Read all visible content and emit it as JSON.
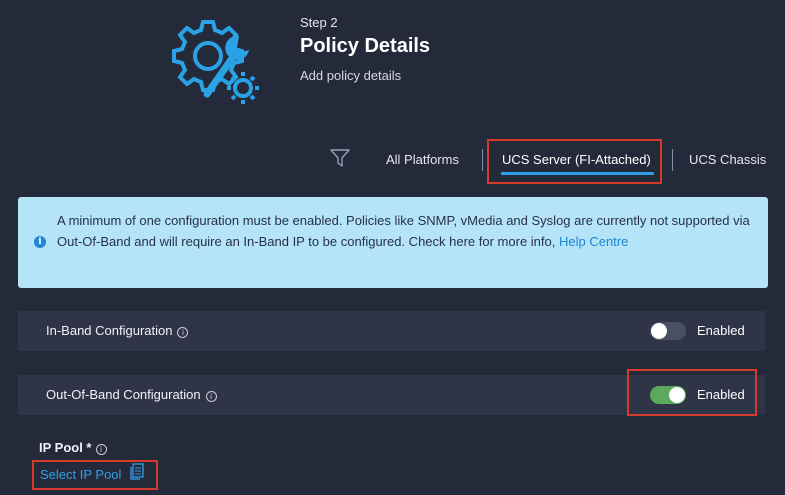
{
  "step": {
    "label": "Step 2",
    "title": "Policy Details",
    "subtitle": "Add policy details",
    "icon": "settings-gear-wrench-icon"
  },
  "platform_tabs": [
    {
      "label": "All Platforms",
      "selected": false
    },
    {
      "label": "UCS Server (FI-Attached)",
      "selected": true
    },
    {
      "label": "UCS Chassis",
      "selected": false
    }
  ],
  "info_banner": {
    "text": "A minimum of one configuration must be enabled. Policies like SNMP, vMedia and Syslog are currently not supported via Out-Of-Band and will require an In-Band IP to be configured. Check here for more info, ",
    "link_text": "Help Centre",
    "icon": "info-icon"
  },
  "inband": {
    "label": "In-Band Configuration",
    "toggle_label": "Enabled",
    "enabled": false
  },
  "oob": {
    "label": "Out-Of-Band Configuration",
    "toggle_label": "Enabled",
    "enabled": true
  },
  "ip_pool": {
    "label": "IP Pool *",
    "select_label": "Select IP Pool"
  },
  "colors": {
    "background": "#252a3b",
    "accent": "#2fa0e8",
    "banner": "#b5e4f8",
    "toggle_on": "#5aa95c",
    "highlight": "#d8392d"
  }
}
